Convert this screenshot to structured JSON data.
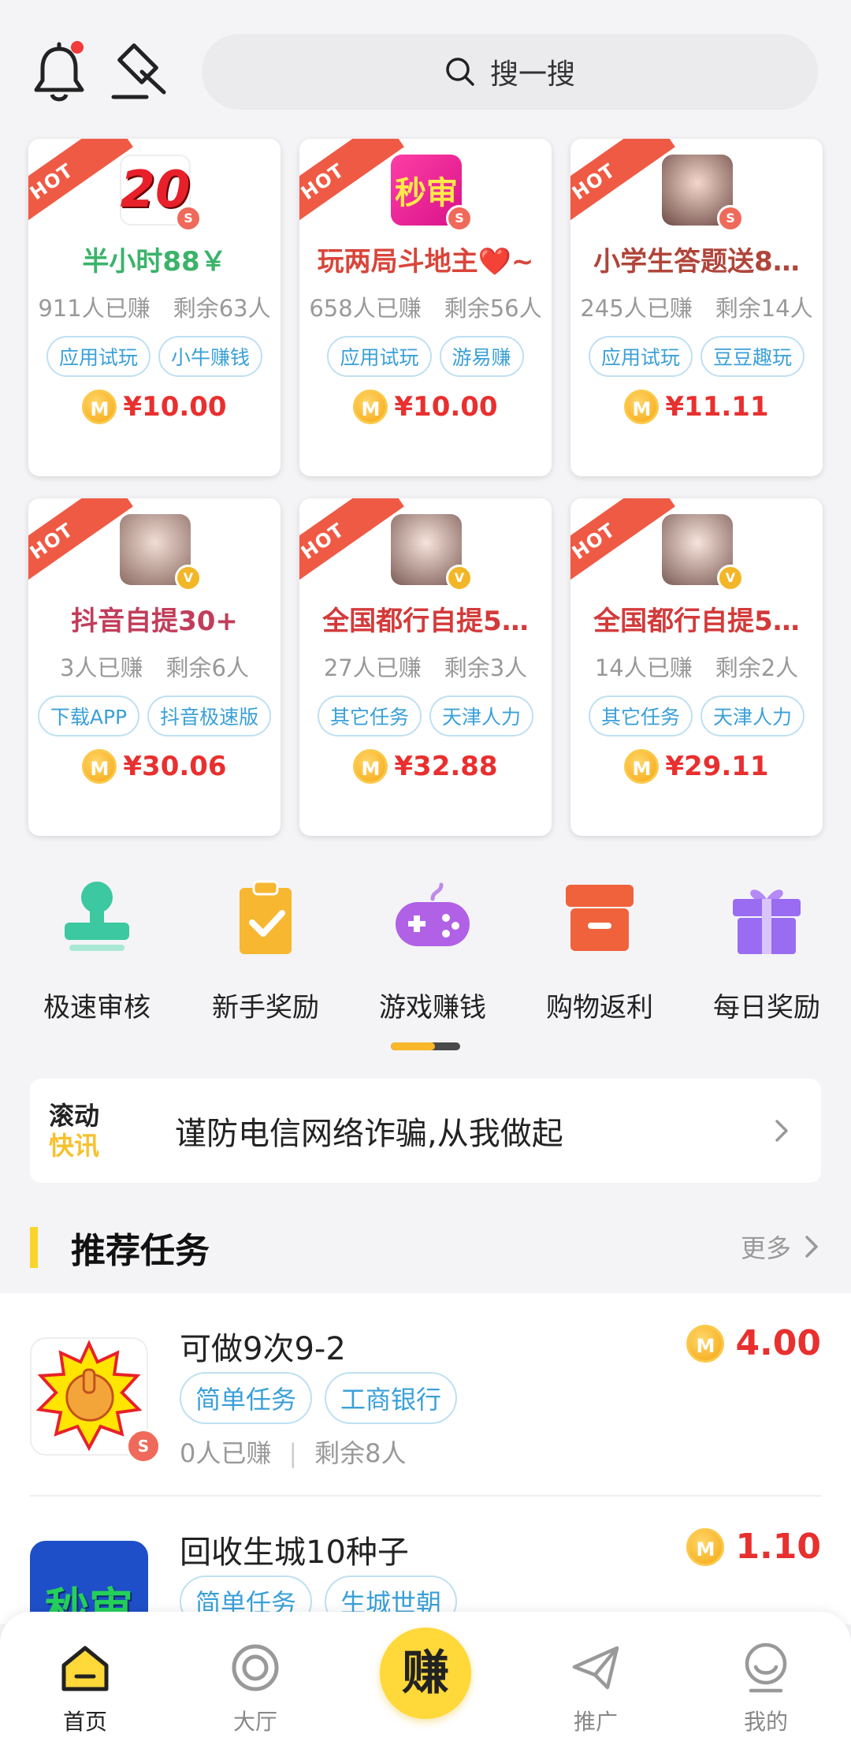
{
  "header": {
    "search_placeholder": "搜一搜"
  },
  "hot_label": "HOT",
  "cards": [
    {
      "icon_text": "20",
      "title": "半小时88￥",
      "stats": "911人已赚　剩余63人",
      "tags": [
        "应用试玩",
        "小牛赚钱"
      ],
      "price": "¥10.00",
      "badge": "S"
    },
    {
      "icon_text": "秒审",
      "title": "玩两局斗地主❤️~",
      "stats": "658人已赚　剩余56人",
      "tags": [
        "应用试玩",
        "游易赚"
      ],
      "price": "¥10.00",
      "badge": "S"
    },
    {
      "icon_text": "",
      "title": "小学生答题送8…",
      "stats": "245人已赚　剩余14人",
      "tags": [
        "应用试玩",
        "豆豆趣玩"
      ],
      "price": "¥11.11",
      "badge": "S"
    },
    {
      "icon_text": "",
      "title": "抖音自提30+",
      "stats": "3人已赚　剩余6人",
      "tags": [
        "下载APP",
        "抖音极速版"
      ],
      "price": "¥30.06",
      "badge": "V"
    },
    {
      "icon_text": "",
      "title": "全国都行自提5…",
      "stats": "27人已赚　剩余3人",
      "tags": [
        "其它任务",
        "天津人力"
      ],
      "price": "¥32.88",
      "badge": "V"
    },
    {
      "icon_text": "",
      "title": "全国都行自提5…",
      "stats": "14人已赚　剩余2人",
      "tags": [
        "其它任务",
        "天津人力"
      ],
      "price": "¥29.11",
      "badge": "V"
    }
  ],
  "coin_symbol": "M",
  "categories": [
    {
      "label": "极速审核",
      "icon": "stamp-icon",
      "color": "#3cc8a0"
    },
    {
      "label": "新手奖励",
      "icon": "clipboard-check-icon",
      "color": "#f7b731"
    },
    {
      "label": "游戏赚钱",
      "icon": "gamepad-icon",
      "color": "#b061e6"
    },
    {
      "label": "购物返利",
      "icon": "box-icon",
      "color": "#f0623c"
    },
    {
      "label": "每日奖励",
      "icon": "gift-icon",
      "color": "#9a6cf2"
    }
  ],
  "notice": {
    "logo_line1": "滚动",
    "logo_line2": "快讯",
    "text": "谨防电信网络诈骗,从我做起"
  },
  "section": {
    "title": "推荐任务",
    "more": "更多"
  },
  "recommend": [
    {
      "name": "可做9次9-2",
      "tags": [
        "简单任务",
        "工商银行"
      ],
      "earned": "0人已赚",
      "remain": "剩余8人",
      "amount": "4.00"
    },
    {
      "name": "回收生城10种子",
      "tags": [
        "简单任务",
        "生城世朝"
      ],
      "earned": "",
      "remain": "",
      "amount": "1.10"
    }
  ],
  "nav": {
    "home": "首页",
    "hall": "大厅",
    "earn": "赚",
    "promote": "推广",
    "mine": "我的"
  },
  "colors": {
    "accent": "#ffd83a",
    "price": "#e8302f",
    "tag": "#3aa0d8",
    "hot": "#ef5a45"
  }
}
